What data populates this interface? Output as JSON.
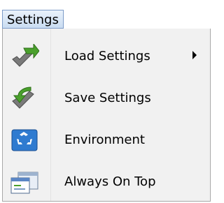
{
  "menubar": {
    "title": "Settings"
  },
  "menu": {
    "items": [
      {
        "label": "Load Settings",
        "icon": "load-settings-icon",
        "has_submenu": true
      },
      {
        "label": "Save Settings",
        "icon": "save-settings-icon",
        "has_submenu": false
      },
      {
        "label": "Environment",
        "icon": "environment-icon",
        "has_submenu": false
      },
      {
        "label": "Always On Top",
        "icon": "always-on-top-icon",
        "has_submenu": false
      }
    ]
  },
  "colors": {
    "menu_background": "#f1f1f1",
    "title_highlight": "#c9dcf1",
    "icon_green": "#4aa02c",
    "icon_blue": "#2f7bd0"
  }
}
